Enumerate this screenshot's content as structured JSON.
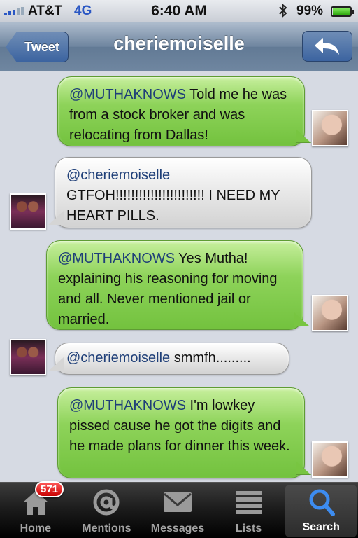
{
  "status_bar": {
    "carrier": "AT&T",
    "network": "4G",
    "time": "6:40 AM",
    "battery_pct": "99",
    "battery_symbol": "%",
    "battery_level": 0.99
  },
  "nav": {
    "back_label": "Tweet",
    "title": "cheriemoiselle"
  },
  "messages": [
    {
      "direction": "out",
      "mention": "@MUTHAKNOWS",
      "text": " Told me he was from a stock broker and was relocating from Dallas!"
    },
    {
      "direction": "in",
      "mention": "@cheriemoiselle",
      "text": "GTFOH!!!!!!!!!!!!!!!!!!!!!!! I NEED MY HEART PILLS."
    },
    {
      "direction": "out",
      "mention": "@MUTHAKNOWS",
      "text": " Yes Mutha! explaining his reasoning for moving and all. Never mentioned jail or married."
    },
    {
      "direction": "in",
      "mention": "@cheriemoiselle",
      "text": " smmfh........."
    },
    {
      "direction": "out",
      "mention": "@MUTHAKNOWS",
      "text": " I'm lowkey pissed cause he got the digits and he made plans for dinner this week."
    }
  ],
  "tabs": [
    {
      "label": "Home",
      "icon": "home-icon",
      "badge": "571",
      "active": false
    },
    {
      "label": "Mentions",
      "icon": "at-icon",
      "active": false
    },
    {
      "label": "Messages",
      "icon": "envelope-icon",
      "active": false
    },
    {
      "label": "Lists",
      "icon": "list-icon",
      "active": false
    },
    {
      "label": "Search",
      "icon": "search-icon",
      "active": true
    }
  ],
  "colors": {
    "outgoing_bubble": "#8ed35a",
    "incoming_bubble": "#e6e6e6",
    "nav_bar": "#6e859f",
    "badge": "#d40000"
  }
}
